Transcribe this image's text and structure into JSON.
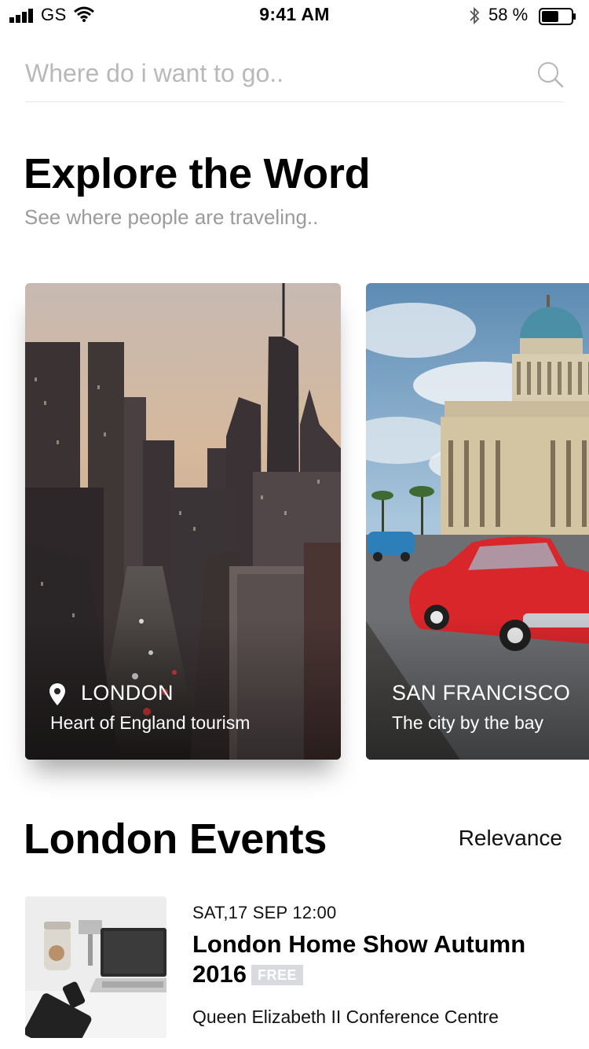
{
  "status_bar": {
    "carrier": "GS",
    "time": "9:41 AM",
    "battery_percent": "58 %",
    "battery_level": 0.58
  },
  "search": {
    "placeholder": "Where do i want to go..",
    "icon": "search-icon"
  },
  "header": {
    "title": "Explore the Word",
    "subtitle": "See where people are traveling.."
  },
  "destinations": [
    {
      "city": "LONDON",
      "tagline": "Heart of England tourism",
      "icon": "location-pin-icon"
    },
    {
      "city": "SAN FRANCISCO",
      "tagline": "The city by the bay"
    }
  ],
  "events_section": {
    "title": "London Events",
    "sort_label": "Relevance"
  },
  "events": [
    {
      "date": "SAT,17 SEP 12:00",
      "title": "London Home Show Autumn 2016",
      "badge": "FREE",
      "venue": "Queen Elizabeth II Conference Centre"
    }
  ],
  "colors": {
    "placeholder": "#b9b9b9",
    "subtitle": "#9b9b9b",
    "badge_bg": "#d9d9e0",
    "classic_car": "#d8262b"
  }
}
